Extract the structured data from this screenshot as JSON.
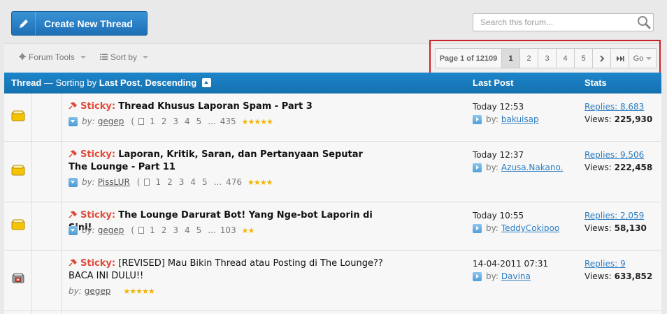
{
  "create_button": {
    "label": "Create New Thread",
    "icon": "pencil-icon"
  },
  "search": {
    "placeholder": "Search this forum...",
    "value": ""
  },
  "toolbar": {
    "forum_tools": "Forum Tools",
    "sort_by": "Sort by"
  },
  "pagination": {
    "info": "Page 1 of 12109",
    "pages": [
      "1",
      "2",
      "3",
      "4",
      "5"
    ],
    "current": "1",
    "next": "›",
    "last": "⏭",
    "go": "Go"
  },
  "header": {
    "thread": "Thread",
    "sort_text": " — Sorting by ",
    "sort_field": "Last Post",
    "sort_sep": ", ",
    "sort_dir": "Descending",
    "last_post": "Last Post",
    "stats": "Stats"
  },
  "threads": [
    {
      "prefix": "Sticky:",
      "title": "Thread Khusus Laporan Spam - Part 3",
      "bold": true,
      "by": "by:",
      "author": "gegep",
      "pages": [
        "1",
        "2",
        "3",
        "4",
        "5",
        "...",
        "435"
      ],
      "rating": 5,
      "last_time": "Today 12:53",
      "last_by": "by:",
      "last_user": "bakuisap",
      "replies": "Replies: 8,683",
      "views_label": "Views: ",
      "views": "225,930",
      "icon": "folder-yellow-icon"
    },
    {
      "prefix": "Sticky:",
      "title": "Laporan, Kritik, Saran, dan Pertanyaan Seputar The Lounge - Part 11",
      "bold": true,
      "by": "by:",
      "author": "PissLUR",
      "pages": [
        "1",
        "2",
        "3",
        "4",
        "5",
        "...",
        "476"
      ],
      "rating": 4,
      "last_time": "Today 12:37",
      "last_by": "by:",
      "last_user": "Azusa.Nakano.",
      "replies": "Replies: 9,506",
      "views_label": "Views: ",
      "views": "222,458",
      "icon": "folder-yellow-icon"
    },
    {
      "prefix": "Sticky:",
      "title": "The Lounge Darurat Bot! Yang Nge-bot Laporin di Sini!",
      "bold": true,
      "by": "by:",
      "author": "gegep",
      "pages": [
        "1",
        "2",
        "3",
        "4",
        "5",
        "...",
        "103"
      ],
      "rating": 2,
      "last_time": "Today 10:55",
      "last_by": "by:",
      "last_user": "TeddyCokipoo",
      "replies": "Replies: 2,059",
      "views_label": "Views: ",
      "views": "58,130",
      "icon": "folder-yellow-icon"
    },
    {
      "prefix": "Sticky:",
      "title": "[REVISED] Mau Bikin Thread atau Posting di The Lounge?? BACA INI DULU!!",
      "bold": false,
      "by": "by:",
      "author": "gegep",
      "pages": [],
      "rating": 5,
      "last_time": "14-04-2011 07:31",
      "last_by": "by:",
      "last_user": "Davina",
      "replies": "Replies: 9",
      "views_label": "Views: ",
      "views": "633,852",
      "icon": "folder-locked-icon"
    }
  ],
  "colors": {
    "header_blue": "#1571b0",
    "accent_red": "#e04a3a",
    "link_blue": "#2b7cc1",
    "highlight": "#cc2127"
  }
}
